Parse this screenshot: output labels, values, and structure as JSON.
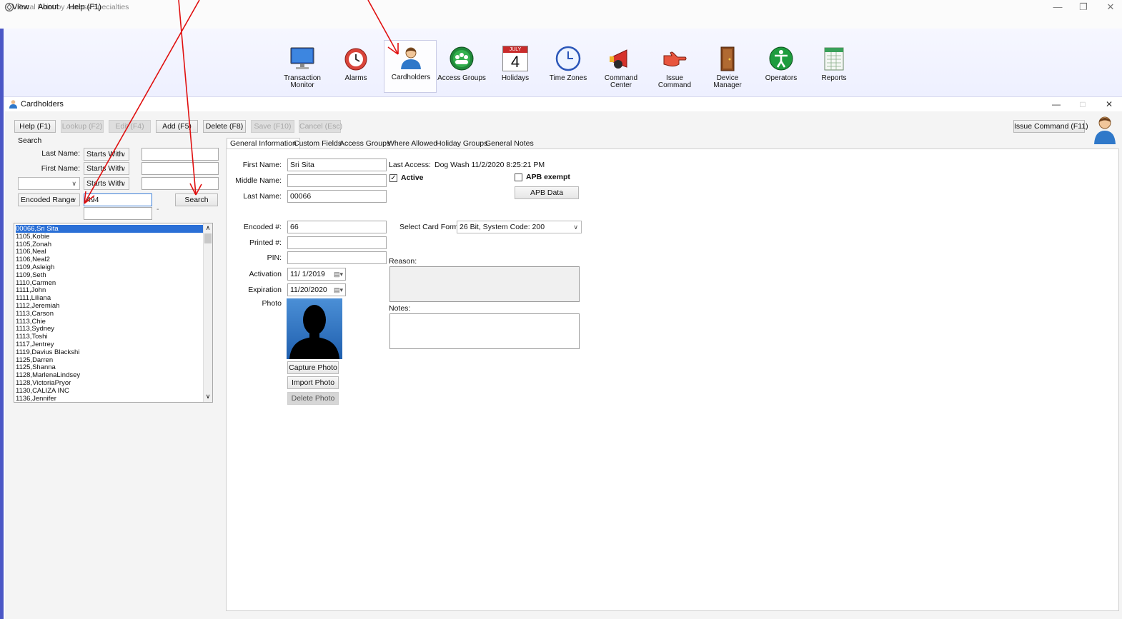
{
  "app": {
    "title": "Focal Point by Access Specialties",
    "menu": [
      "View",
      "About",
      "Help (F1)"
    ]
  },
  "toolbar": [
    {
      "label": "Transaction\nMonitor",
      "icon": "monitor-icon"
    },
    {
      "label": "Alarms",
      "icon": "alarm-clock-icon"
    },
    {
      "label": "Cardholders",
      "icon": "cardholder-person-icon"
    },
    {
      "label": "Access Groups",
      "icon": "access-groups-globe-icon"
    },
    {
      "label": "Holidays",
      "icon": "calendar-icon"
    },
    {
      "label": "Time Zones",
      "icon": "clock-icon"
    },
    {
      "label": "Command\nCenter",
      "icon": "megaphone-icon"
    },
    {
      "label": "Issue\nCommand",
      "icon": "pointing-hand-icon"
    },
    {
      "label": "Device\nManager",
      "icon": "door-icon"
    },
    {
      "label": "Operators",
      "icon": "person-circle-icon"
    },
    {
      "label": "Reports",
      "icon": "report-sheet-icon"
    }
  ],
  "calendar_icon": {
    "month": "JULY",
    "day": "4"
  },
  "window": {
    "title": "Cardholders"
  },
  "actions": {
    "help": "Help (F1)",
    "lookup": "Lookup (F2)",
    "edit": "Edit (F4)",
    "add": "Add (F5)",
    "delete": "Delete (F8)",
    "save": "Save (F10)",
    "cancel": "Cancel (Esc)",
    "issue_command": "Issue Command (F11)"
  },
  "search": {
    "section_label": "Search",
    "last_name_label": "Last Name:",
    "first_name_label": "First Name:",
    "match_mode": "Starts With",
    "last_name_value": "",
    "first_name_value": "",
    "custom_field": "",
    "custom_value": "",
    "range_type": "Encoded Range",
    "range_from": "494",
    "range_to": "",
    "range_dash": "-",
    "search_button": "Search"
  },
  "cardholder_list": [
    "00066,Sri Sita",
    "1105,Kobie",
    "1105,Zonah",
    "1106,Neal",
    "1106,Neal2",
    "1109,Asleigh",
    "1109,Seth",
    "1110,Carmen",
    "1111,John",
    "1111,Liliana",
    "1112,Jeremiah",
    "1113,Carson",
    "1113,Chie",
    "1113,Sydney",
    "1113,Toshi",
    "1117,Jentrey",
    "1119,Davius Blackshi",
    "1125,Darren",
    "1125,Shanna",
    "1128,MarlenaLindsey",
    "1128,VictoriaPryor",
    "1130,CALIZA INC",
    "1136,Jennifer"
  ],
  "tabs": [
    "General Information",
    "Custom Fields",
    "Access Groups",
    "Where Allowed",
    "Holiday Groups",
    "General Notes"
  ],
  "general": {
    "first_name_label": "First Name:",
    "first_name": "Sri Sita",
    "middle_name_label": "Middle Name:",
    "middle_name": "",
    "last_name_label": "Last Name:",
    "last_name": "00066",
    "last_access_label": "Last Access:",
    "last_access": "Dog Wash 11/2/2020 8:25:21 PM",
    "active_label": "Active",
    "active_checked": true,
    "apb_exempt_label": "APB exempt",
    "apb_exempt_checked": false,
    "apb_data_button": "APB Data",
    "encoded_label": "Encoded #:",
    "encoded": "66",
    "card_format_label": "Select Card Format",
    "card_format": "26 Bit, System Code: 200",
    "printed_label": "Printed #:",
    "printed": "",
    "pin_label": "PIN:",
    "pin": "",
    "reason_label": "Reason:",
    "activation_label": "Activation",
    "activation": "11/ 1/2019",
    "expiration_label": "Expiration",
    "expiration": "11/20/2020",
    "photo_label": "Photo",
    "notes_label": "Notes:",
    "capture_photo": "Capture Photo",
    "import_photo": "Import Photo",
    "delete_photo": "Delete Photo"
  },
  "colors": {
    "accent_bar": "#4b57c6",
    "selection": "#2a6fd6",
    "annotation_arrow": "#e01010"
  }
}
